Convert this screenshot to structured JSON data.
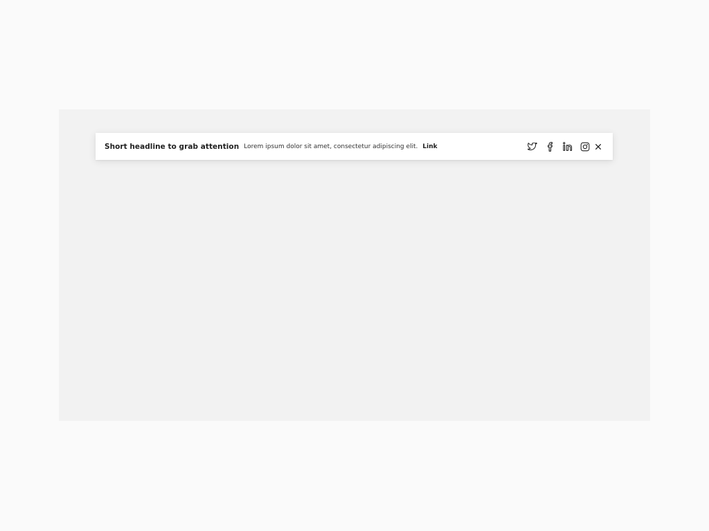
{
  "banner": {
    "headline": "Short headline to grab attention",
    "body": "Lorem ipsum dolor sit amet, consectetur adipiscing elit.",
    "link_label": "Link"
  },
  "social_icons": [
    "twitter-icon",
    "facebook-icon",
    "linkedin-icon",
    "instagram-icon"
  ],
  "close_icon": "close-icon",
  "colors": {
    "page_background": "#fafafa",
    "stage_background": "#f2f2f2",
    "banner_background": "#ffffff",
    "text": "#1f1f1f"
  }
}
